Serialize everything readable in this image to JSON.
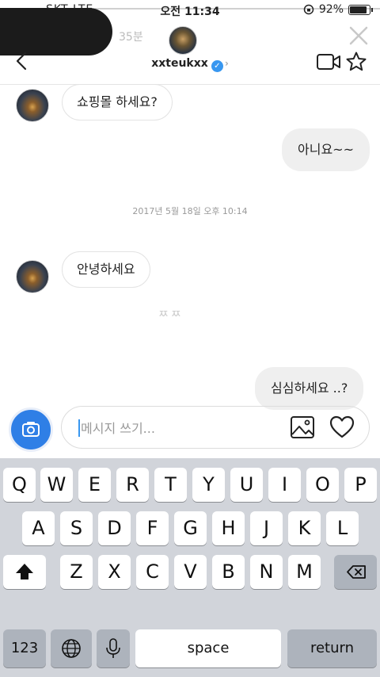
{
  "status_bar": {
    "carrier": "SKT  LTE",
    "time": "오전 11:34",
    "battery": "92%"
  },
  "story": {
    "elapsed": "35분"
  },
  "header": {
    "username": "xxteukxx",
    "verified_icon": "verified-badge-icon"
  },
  "messages": [
    {
      "direction": "incoming",
      "text": "쇼핑몰 하세요?"
    },
    {
      "direction": "outgoing",
      "text": "아니요~~"
    },
    {
      "direction": "timestamp",
      "text": "2017년 5월 18일 오후 10:14"
    },
    {
      "direction": "incoming",
      "text": "안녕하세요"
    },
    {
      "direction": "typing",
      "text": "ㅉㅉ"
    },
    {
      "direction": "outgoing",
      "text": "심심하세요 ..?"
    }
  ],
  "composer": {
    "placeholder": "메시지 쓰기..."
  },
  "keyboard": {
    "row1": [
      "Q",
      "W",
      "E",
      "R",
      "T",
      "Y",
      "U",
      "I",
      "O",
      "P"
    ],
    "row2": [
      "A",
      "S",
      "D",
      "F",
      "G",
      "H",
      "J",
      "K",
      "L"
    ],
    "row3": [
      "Z",
      "X",
      "C",
      "V",
      "B",
      "N",
      "M"
    ],
    "numbers_label": "123",
    "space_label": "space",
    "return_label": "return"
  },
  "colors": {
    "accent": "#3897f0",
    "camera_button": "#2f7fe6",
    "keyboard_bg": "#d1d4da"
  }
}
